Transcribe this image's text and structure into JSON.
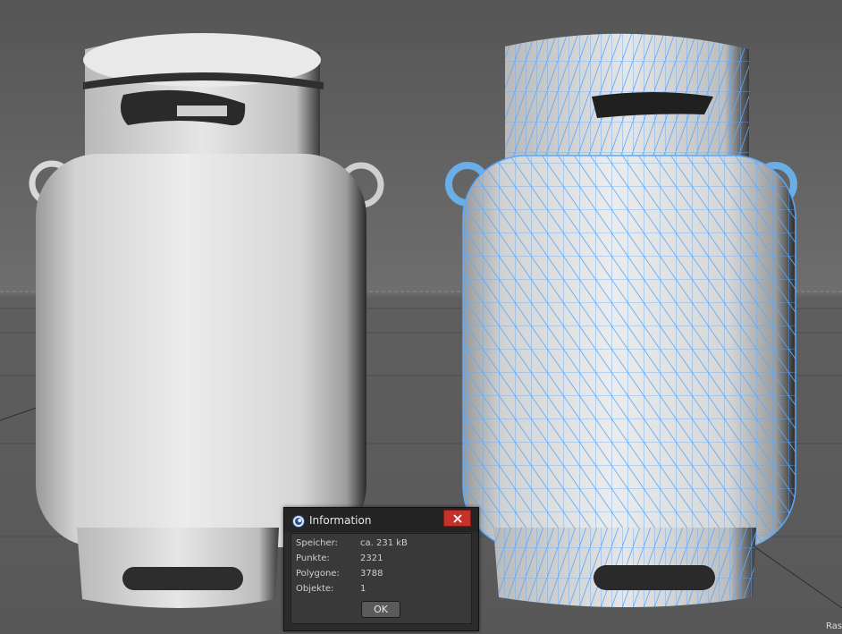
{
  "viewport": {
    "corner_label": "Ras"
  },
  "dialog": {
    "title": "Information",
    "rows": [
      {
        "label": "Speicher:",
        "value": "ca. 231 kB"
      },
      {
        "label": "Punkte:",
        "value": "2321"
      },
      {
        "label": "Polygone:",
        "value": "3788"
      },
      {
        "label": "Objekte:",
        "value": "1"
      }
    ],
    "ok_label": "OK"
  },
  "colors": {
    "viewport_background": "#5c5c5c",
    "wireframe": "#5aa9ff",
    "close_button": "#c8312a"
  },
  "icons": [
    "cinema4d-app-icon",
    "close-icon"
  ]
}
